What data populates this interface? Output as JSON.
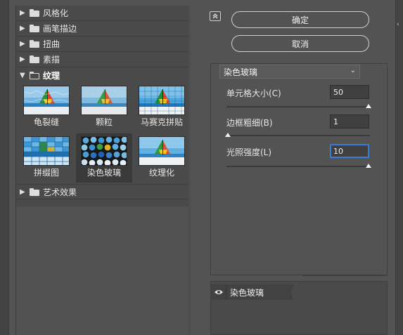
{
  "gallery": {
    "categories_top": [
      {
        "label": "风格化"
      },
      {
        "label": "画笔描边"
      },
      {
        "label": "扭曲"
      },
      {
        "label": "素描"
      }
    ],
    "active_category": {
      "label": "纹理"
    },
    "thumbnails": [
      {
        "label": "龟裂缝"
      },
      {
        "label": "颗粒"
      },
      {
        "label": "马赛克拼贴"
      },
      {
        "label": "拼缀图"
      },
      {
        "label": "染色玻璃"
      },
      {
        "label": "纹理化"
      }
    ],
    "categories_bottom": [
      {
        "label": "艺术效果"
      }
    ],
    "selected_thumbnail": "染色玻璃"
  },
  "actions": {
    "ok_label": "确定",
    "cancel_label": "取消"
  },
  "settings": {
    "filter_selected": "染色玻璃",
    "params": [
      {
        "label": "单元格大小(C)",
        "value": "50",
        "fraction": 1.0
      },
      {
        "label": "边框粗细(B)",
        "value": "1",
        "fraction": 0.0
      },
      {
        "label": "光照强度(L)",
        "value": "10",
        "fraction": 1.0
      }
    ]
  },
  "layers": {
    "items": [
      {
        "label": "染色玻璃"
      }
    ]
  },
  "colors": {
    "background": "#535353",
    "panel": "#4a4a4a",
    "focus": "#3a7bd5"
  }
}
